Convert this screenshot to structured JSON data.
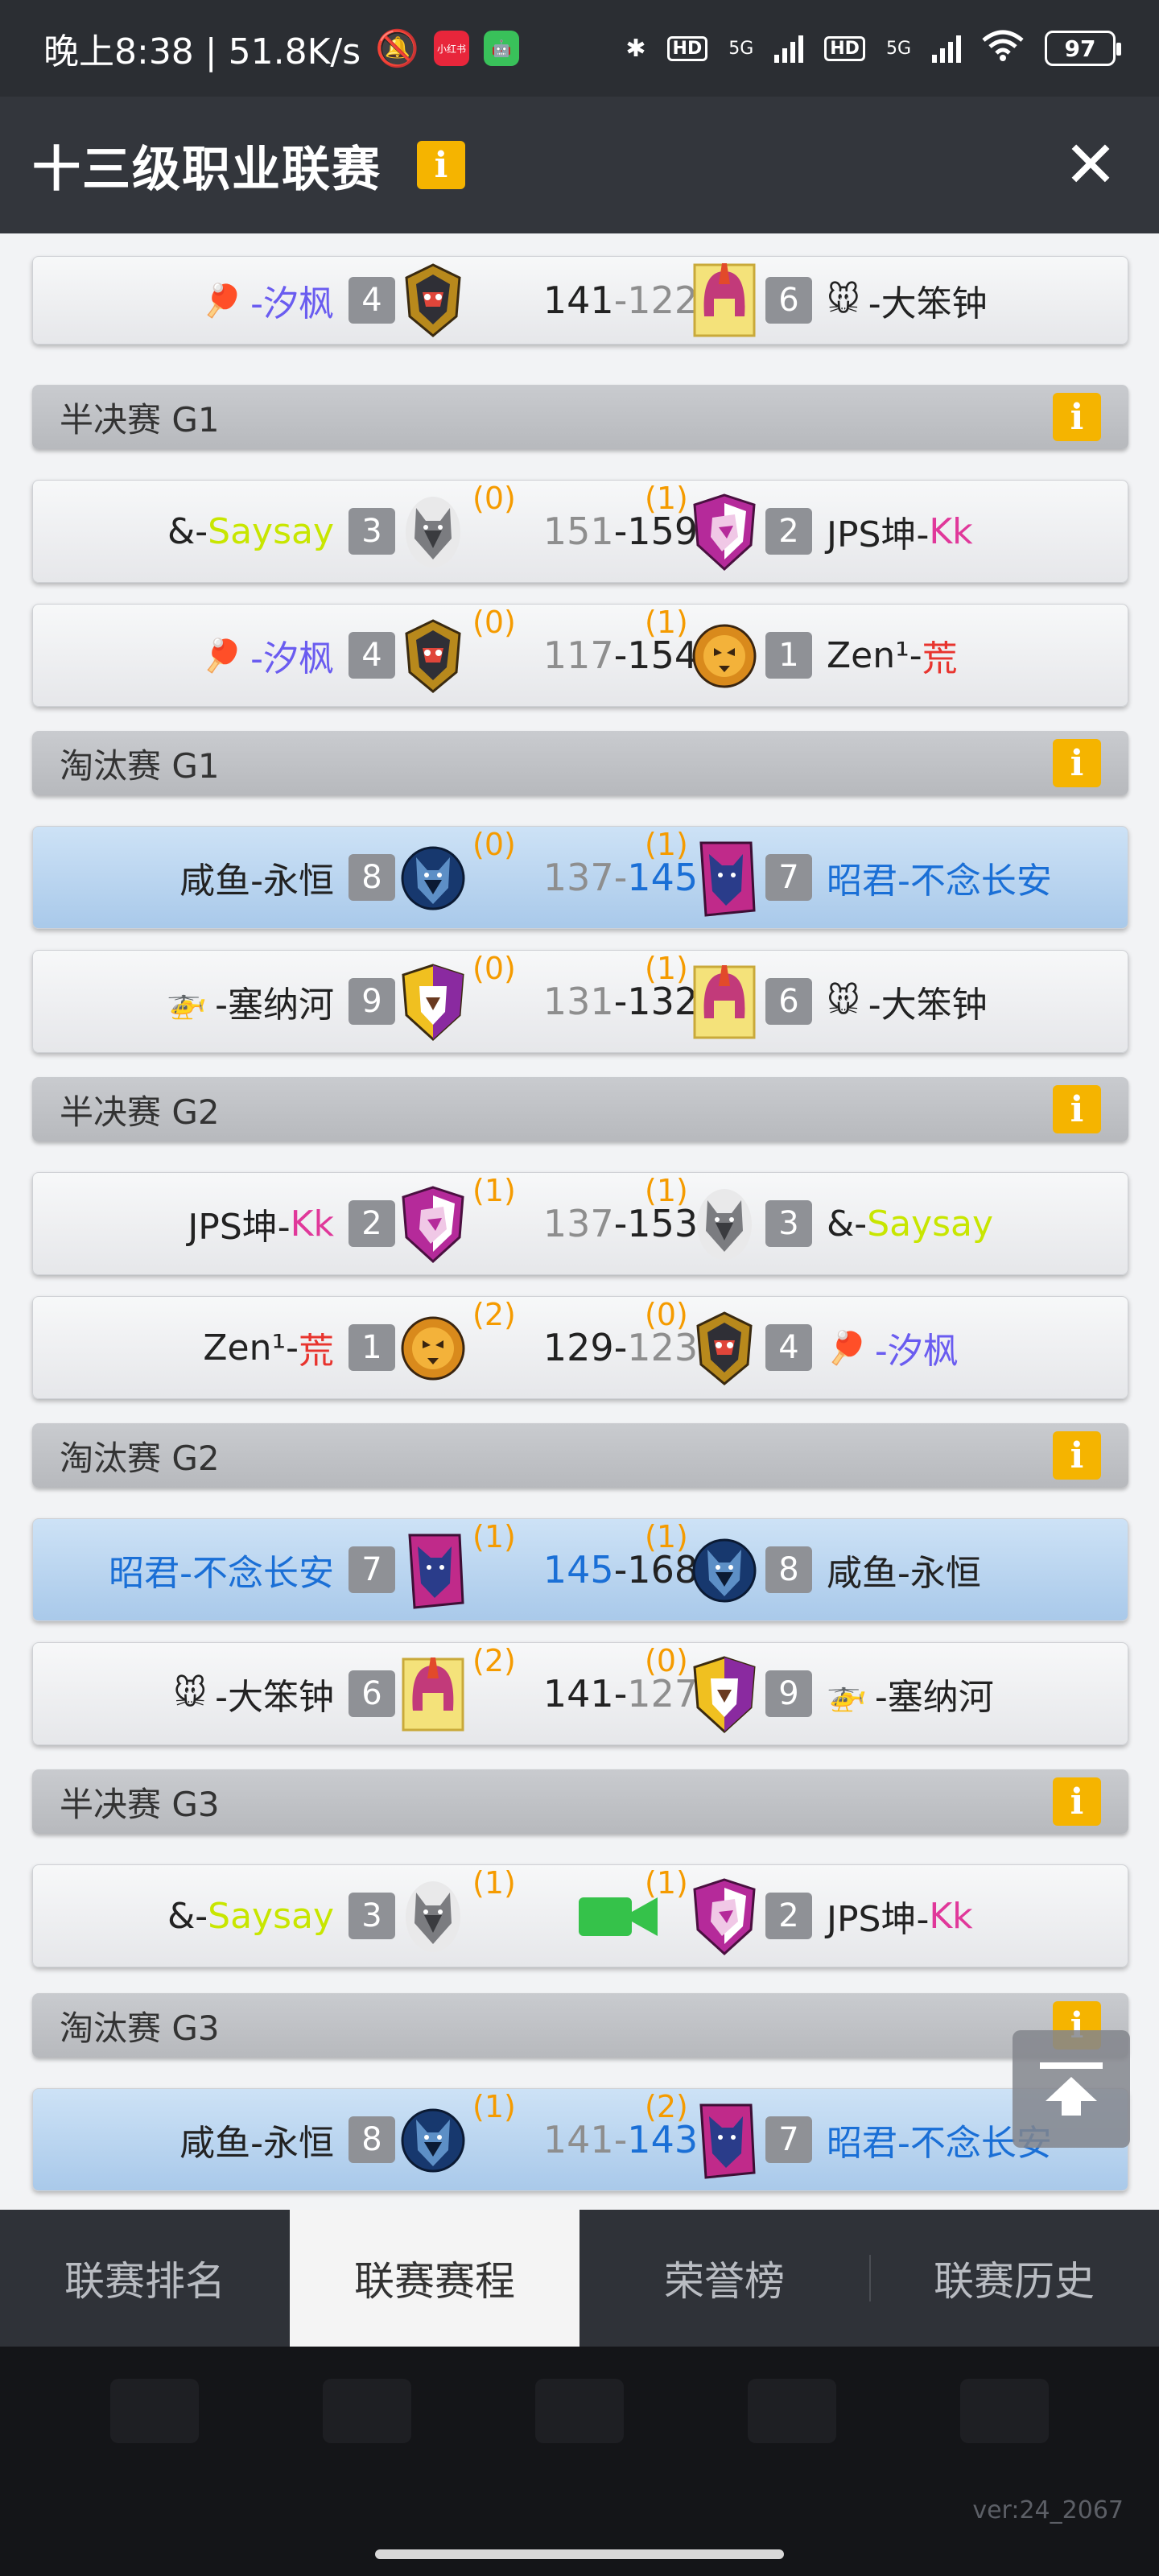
{
  "status_bar": {
    "time_info": "晚上8:38 | 51.8K/s",
    "app_badge_red": "小红书",
    "network_1": "5G",
    "network_2": "5G",
    "hd_1": "HD",
    "hd_2": "HD",
    "battery": "97"
  },
  "header": {
    "title": "十三级职业联赛",
    "info_icon": "i",
    "close_icon": "✕"
  },
  "colors": {
    "accent_info": "#f5b400",
    "wins_count": "#f59b00",
    "highlight_team": "#1a6fd6"
  },
  "schedule": {
    "m0": {
      "left_name": "-汐枫",
      "left_icon": "🏓",
      "left_seed": "4",
      "score_left": "141",
      "score_right": "122",
      "right_seed": "6",
      "right_icon": "🐭",
      "right_name": "-大笨钟"
    },
    "s1": {
      "title": "半决赛 G1",
      "info": "i"
    },
    "m1": {
      "left_prefix": "&-",
      "left_name": "Saysay",
      "left_seed": "3",
      "left_wins": "(0)",
      "score_left": "151",
      "score_right": "159",
      "right_wins": "(1)",
      "right_seed": "2",
      "right_prefix": "JPS坤-",
      "right_name": "Kk"
    },
    "m2": {
      "left_icon": "🏓",
      "left_name": "-汐枫",
      "left_seed": "4",
      "left_wins": "(0)",
      "score_left": "117",
      "score_right": "154",
      "right_wins": "(1)",
      "right_seed": "1",
      "right_prefix": "Zen¹-",
      "right_name": "荒"
    },
    "s2": {
      "title": "淘汰赛 G1",
      "info": "i"
    },
    "m3": {
      "left_name": "咸鱼-永恒",
      "left_seed": "8",
      "left_wins": "(0)",
      "score_left": "137",
      "score_right": "145",
      "right_wins": "(1)",
      "right_seed": "7",
      "right_name": "昭君-不念长安"
    },
    "m4": {
      "left_icon": "🚁",
      "left_name": "-塞纳河",
      "left_seed": "9",
      "left_wins": "(0)",
      "score_left": "131",
      "score_right": "132",
      "right_wins": "(1)",
      "right_seed": "6",
      "right_icon": "🐭",
      "right_name": "-大笨钟"
    },
    "s3": {
      "title": "半决赛 G2",
      "info": "i"
    },
    "m5": {
      "left_prefix": "JPS坤-",
      "left_name": "Kk",
      "left_seed": "2",
      "left_wins": "(1)",
      "score_left": "137",
      "score_right": "153",
      "right_wins": "(1)",
      "right_seed": "3",
      "right_prefix": "&-",
      "right_name": "Saysay"
    },
    "m6": {
      "left_prefix": "Zen¹-",
      "left_name": "荒",
      "left_seed": "1",
      "left_wins": "(2)",
      "score_left": "129",
      "score_right": "123",
      "right_wins": "(0)",
      "right_seed": "4",
      "right_icon": "🏓",
      "right_name": "-汐枫"
    },
    "s4": {
      "title": "淘汰赛 G2",
      "info": "i"
    },
    "m7": {
      "left_name": "昭君-不念长安",
      "left_seed": "7",
      "left_wins": "(1)",
      "score_left": "145",
      "score_right": "168",
      "right_wins": "(1)",
      "right_seed": "8",
      "right_name": "咸鱼-永恒"
    },
    "m8": {
      "left_icon": "🐭",
      "left_name": "-大笨钟",
      "left_seed": "6",
      "left_wins": "(2)",
      "score_left": "141",
      "score_right": "127",
      "right_wins": "(0)",
      "right_seed": "9",
      "right_icon": "🚁",
      "right_name": "-塞纳河"
    },
    "s5": {
      "title": "半决赛 G3",
      "info": "i"
    },
    "m9": {
      "left_prefix": "&-",
      "left_name": "Saysay",
      "left_seed": "3",
      "left_wins": "(1)",
      "right_wins": "(1)",
      "right_seed": "2",
      "right_prefix": "JPS坤-",
      "right_name": "Kk"
    },
    "s6": {
      "title": "淘汰赛 G3",
      "info": "i"
    },
    "m10": {
      "left_name": "咸鱼-永恒",
      "left_seed": "8",
      "left_wins": "(1)",
      "score_left": "141",
      "score_right": "143",
      "right_wins": "(2)",
      "right_seed": "7",
      "right_name": "昭君-不念长安"
    }
  },
  "tabs": {
    "t1": "联赛排名",
    "t2": "联赛赛程",
    "t3": "荣誉榜",
    "t4": "联赛历史"
  },
  "version": "ver:24_2067"
}
